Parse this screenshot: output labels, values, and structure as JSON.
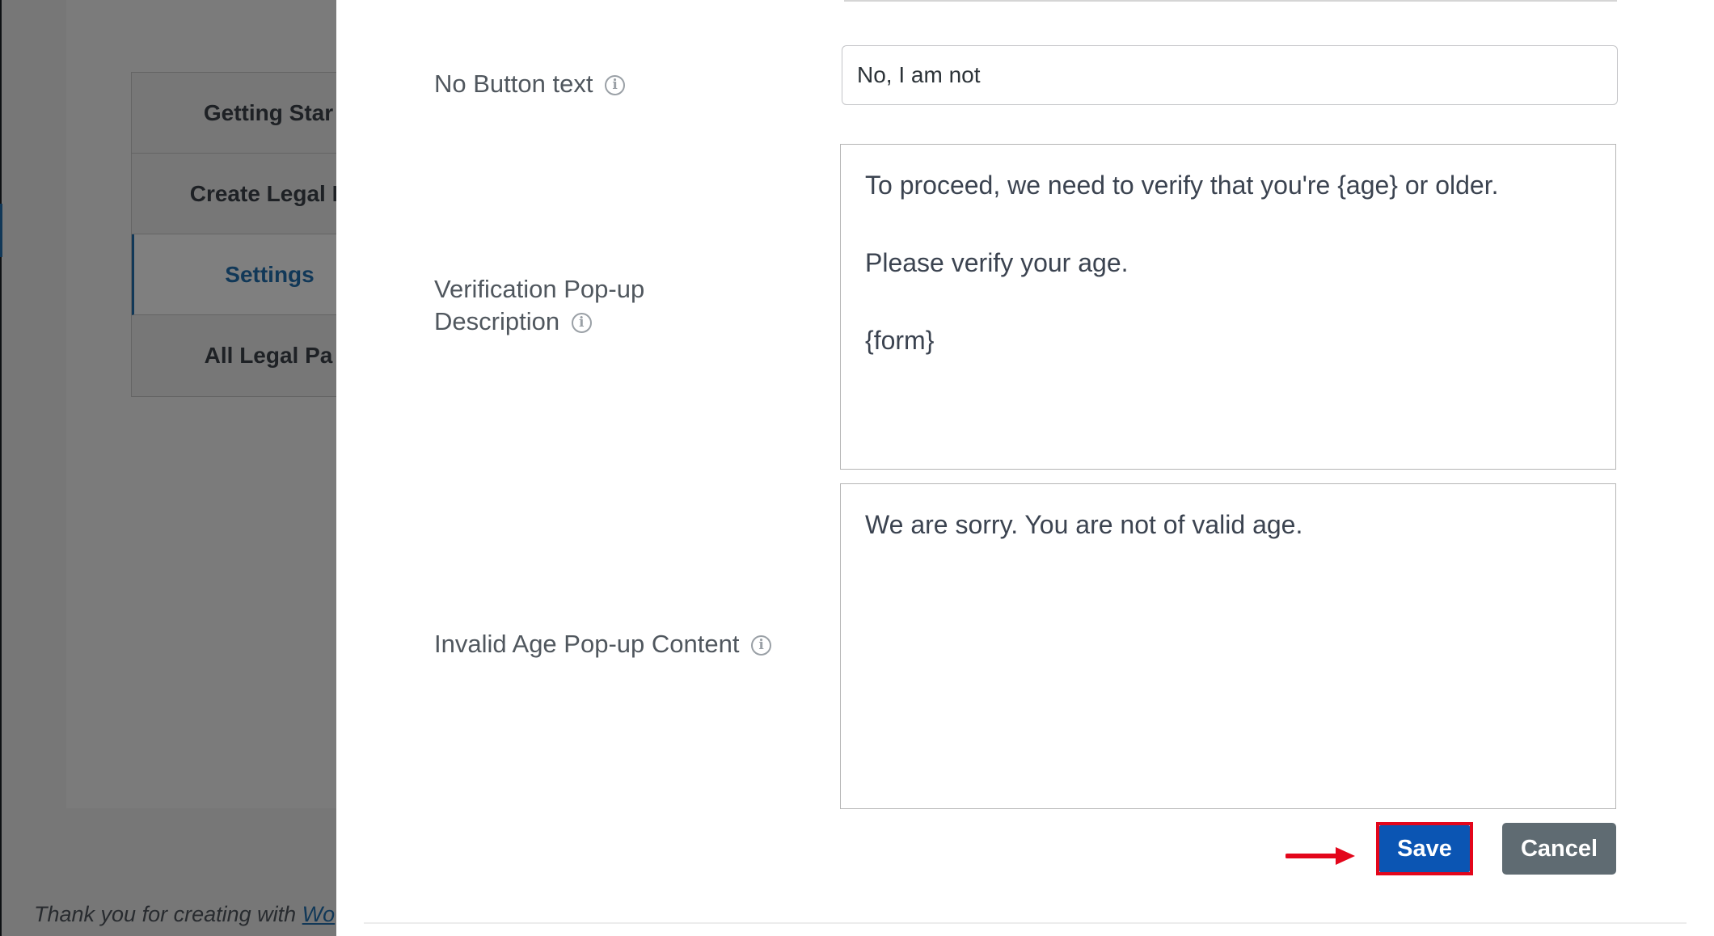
{
  "background_page": {
    "tabs": [
      {
        "label": "Getting Star"
      },
      {
        "label": "Create Legal P"
      },
      {
        "label": "Settings"
      },
      {
        "label": "All Legal Pa"
      }
    ],
    "active_tab_index": 2,
    "footer": {
      "text": "Thank you for creating with ",
      "link_text": "Wo"
    }
  },
  "modal": {
    "no_button_text": {
      "label": "No Button text",
      "value": "No, I am not"
    },
    "verification_description": {
      "label_line1": "Verification Pop-up",
      "label_line2": "Description",
      "lines": [
        "To proceed, we need to verify that you're {age} or older.",
        "",
        "Please verify your age.",
        "",
        "{form}"
      ]
    },
    "invalid_age_content": {
      "label": "Invalid Age Pop-up Content",
      "lines": [
        "We are sorry. You are not of valid age."
      ]
    },
    "actions": {
      "save_label": "Save",
      "cancel_label": "Cancel"
    }
  },
  "icons": {
    "info": "info-circle-icon",
    "arrow": "red-arrow-right-icon"
  },
  "colors": {
    "save_button": "#0b55b3",
    "save_highlight": "#e3061b",
    "cancel_button": "#5f6b72",
    "active_tab": "#2271b1"
  }
}
